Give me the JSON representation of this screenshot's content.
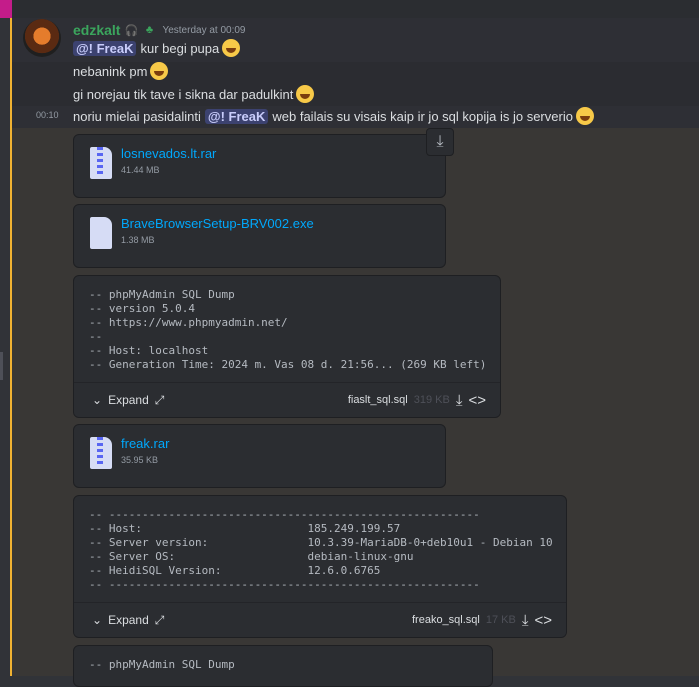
{
  "message": {
    "username": "edzkalt",
    "timestamp": "Yesterday at 00:09",
    "lines": [
      {
        "mention": "@! FreaK",
        "text": "kur begi pupa"
      },
      {
        "text": "nebanink pm"
      },
      {
        "text": "gi norejau tik tave i sikna dar padulkint"
      }
    ],
    "line4": {
      "time": "00:10",
      "pre": "noriu mielai pasidalinti",
      "mention": "@! FreaK",
      "post": "web failais su visais kaip ir jo sql kopija is jo serverio"
    }
  },
  "attachments": {
    "file1": {
      "name": "losnevados.lt.rar",
      "size": "41.44 MB"
    },
    "file2": {
      "name": "BraveBrowserSetup-BRV002.exe",
      "size": "1.38 MB"
    },
    "code1": {
      "content": "-- phpMyAdmin SQL Dump\n-- version 5.0.4\n-- https://www.phpmyadmin.net/\n--\n-- Host: localhost\n-- Generation Time: 2024 m. Vas 08 d. 21:56... (269 KB left)",
      "expand": "Expand",
      "filename": "fiaslt_sql.sql",
      "filesize": "319 KB"
    },
    "file3": {
      "name": "freak.rar",
      "size": "35.95 KB"
    },
    "code2": {
      "content": "-- --------------------------------------------------------\n-- Host:                         185.249.199.57\n-- Server version:               10.3.39-MariaDB-0+deb10u1 - Debian 10\n-- Server OS:                    debian-linux-gnu\n-- HeidiSQL Version:             12.6.0.6765\n-- --------------------------------------------------------",
      "expand": "Expand",
      "filename": "freako_sql.sql",
      "filesize": "17 KB"
    },
    "code3": {
      "content": "-- phpMyAdmin SQL Dump"
    }
  },
  "icons": {
    "headphones": "headphones-icon",
    "badge": "badge-icon",
    "download": "download-icon",
    "expand": "expand-icon",
    "code": "code-icon",
    "chevron": "chevron-down-icon"
  }
}
